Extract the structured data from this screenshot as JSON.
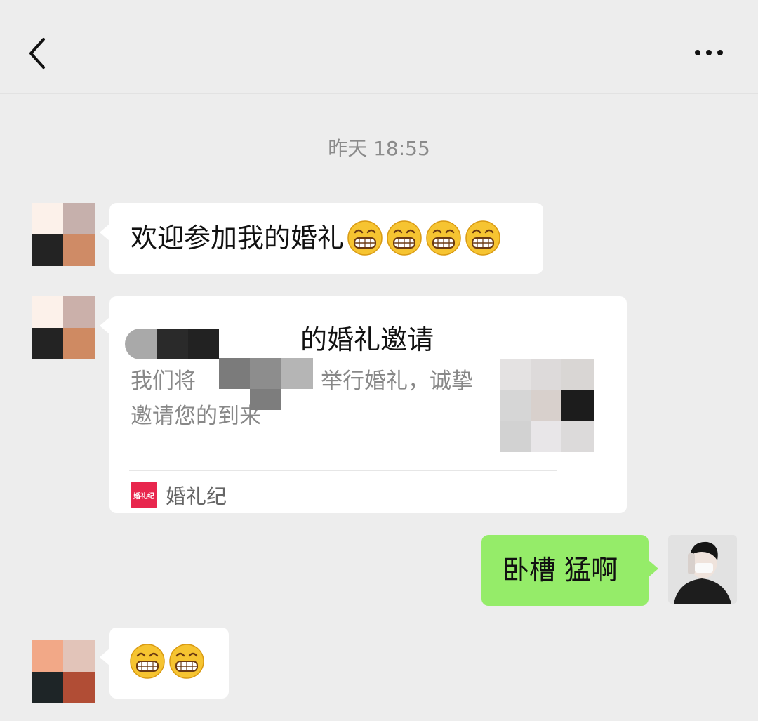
{
  "header": {
    "back_icon": "chevron-left-icon",
    "more_icon": "more-dots-icon"
  },
  "chat": {
    "timestamp": "昨天 18:55",
    "messages": [
      {
        "sender": "contact",
        "text": "欢迎参加我的婚礼",
        "emoji": "grin-emoji",
        "emoji_count": 4
      },
      {
        "sender": "contact",
        "card": {
          "title_visible": "的婚礼邀请",
          "desc_line1_a": "我们将",
          "desc_line1_b": "举行婚礼，诚挚",
          "desc_line2": "邀请您的到来",
          "source_name": "婚礼纪",
          "source_logo_text": "婚礼纪"
        }
      },
      {
        "sender": "me",
        "text": "卧槽 猛啊"
      },
      {
        "sender": "contact",
        "emoji": "grin-emoji",
        "emoji_count": 2
      }
    ]
  },
  "colors": {
    "background": "#ededed",
    "bubble_in": "#ffffff",
    "bubble_out": "#95ec69",
    "timestamp": "#8a8a8a"
  }
}
